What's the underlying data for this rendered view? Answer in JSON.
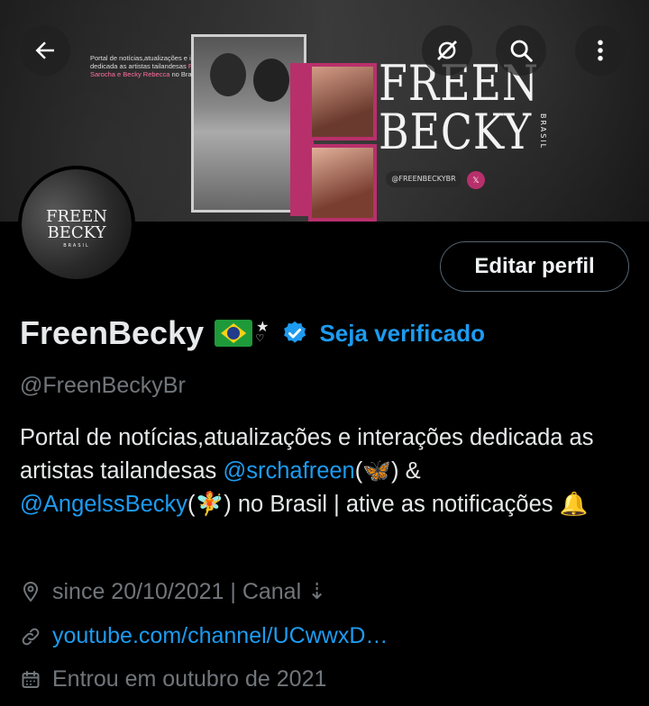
{
  "banner": {
    "tagline_line1": "Portal de notícias,atualizações e",
    "tagline_line2": "interações dedicada as artistas tailandesas",
    "tagline_highlight": "Freen Sarocha e Becky Rebecca",
    "tagline_end": "no Brasil",
    "logo_line1": "FREEN",
    "logo_line2": "BECKY",
    "logo_sub": "BRASIL",
    "handle_pill": "@FREENBECKYBR",
    "x_badge": "𝕏"
  },
  "header": {
    "back_icon": "arrow-left-icon",
    "grok_icon": "grok-icon",
    "search_icon": "search-icon",
    "more_icon": "more-vertical-icon"
  },
  "avatar": {
    "line1": "FREEN",
    "line2": "BECKY",
    "line3": "BRASIL"
  },
  "edit_button_label": "Editar perfil",
  "profile": {
    "display_name": "FreenBecky",
    "star": "★",
    "small_heart": "♡",
    "verify_label": "Seja verificado",
    "handle": "@FreenBeckyBr"
  },
  "bio": {
    "part1": "Portal de notícias,atualizações e interações dedicada as artistas tailandesas ",
    "mention1": "@srchafreen",
    "emoji1": "(🦋)",
    "part2": " & ",
    "mention2": "@AngelssBecky",
    "emoji2": "(🧚)",
    "part3": " no Brasil | ative as notificações ",
    "emoji3": "🔔"
  },
  "meta": {
    "location": "since 20/10/2021 | Canal ⇣",
    "link": "youtube.com/channel/UCwwxD…",
    "joined": "Entrou em outubro de 2021"
  },
  "colors": {
    "accent": "#1d9bf0",
    "muted": "#71767b",
    "text": "#e7e9ea",
    "brand_pink": "#b8306b"
  }
}
